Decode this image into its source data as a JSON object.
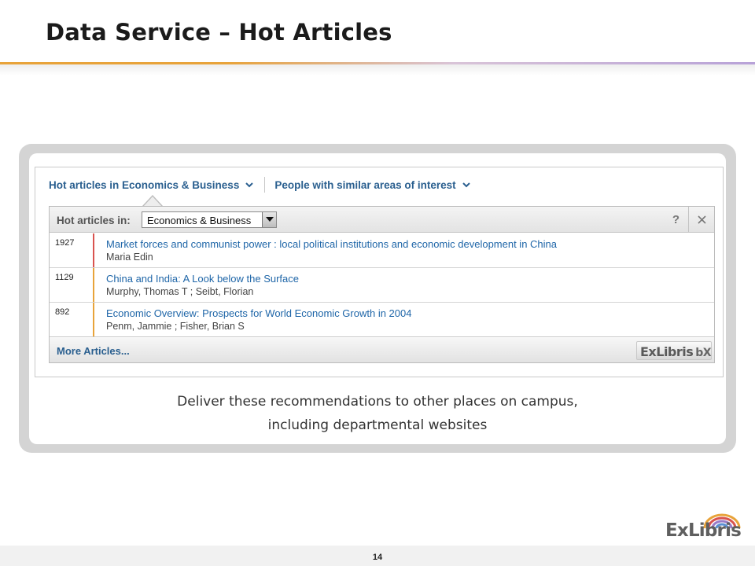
{
  "slide": {
    "title": "Data Service – Hot Articles",
    "caption_line1": "Deliver these recommendations to other places on campus,",
    "caption_line2": "including departmental websites",
    "page_number": "14",
    "logo_text": "ExLibris"
  },
  "widget": {
    "tabs": [
      {
        "label": "Hot articles in Economics & Business"
      },
      {
        "label": "People with similar areas of interest"
      }
    ],
    "header": {
      "label": "Hot articles in:",
      "selected_option": "Economics & Business",
      "help_label": "?"
    },
    "articles": [
      {
        "count": "1927",
        "title": "Market forces and communist power : local political institutions and economic development in China",
        "authors": "Maria Edin",
        "bar_color": "#d9534f"
      },
      {
        "count": "1129",
        "title": "China and India: A Look below the Surface",
        "authors": "Murphy, Thomas T ; Seibt, Florian",
        "bar_color": "#e8a33a"
      },
      {
        "count": "892",
        "title": "Economic Overview: Prospects for World Economic Growth in 2004",
        "authors": "Penm, Jammie ; Fisher, Brian S",
        "bar_color": "#e8a33a"
      }
    ],
    "footer": {
      "more_label": "More Articles...",
      "brand_label": "ExLibris",
      "brand_suffix": "bX"
    }
  },
  "colors": {
    "link": "#1f66a8",
    "accent_orange": "#e8a33a",
    "accent_red": "#d9534f",
    "logo_arc": [
      "#e8a33a",
      "#d9534f",
      "#9b7cc7",
      "#5b8fd1"
    ]
  },
  "icons": [
    "chevron-down-icon",
    "dropdown-arrow-icon",
    "close-icon",
    "rainbow-arc-icon"
  ]
}
